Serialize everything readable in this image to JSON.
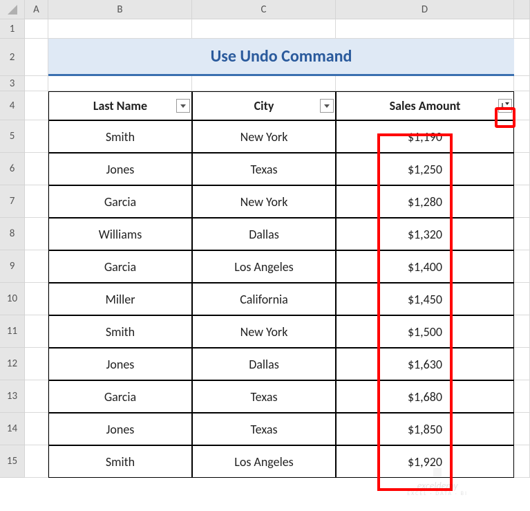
{
  "columns": [
    "A",
    "B",
    "C",
    "D"
  ],
  "rows": [
    "1",
    "2",
    "3",
    "4",
    "5",
    "6",
    "7",
    "8",
    "9",
    "10",
    "11",
    "12",
    "13",
    "14",
    "15"
  ],
  "title": "Use Undo Command",
  "headers": {
    "last_name": "Last Name",
    "city": "City",
    "sales_amount": "Sales Amount"
  },
  "data": [
    {
      "last_name": "Smith",
      "city": "New York",
      "sales": "$1,190"
    },
    {
      "last_name": "Jones",
      "city": "Texas",
      "sales": "$1,250"
    },
    {
      "last_name": "Garcia",
      "city": "New York",
      "sales": "$1,280"
    },
    {
      "last_name": "Williams",
      "city": "Dallas",
      "sales": "$1,320"
    },
    {
      "last_name": "Garcia",
      "city": "Los Angeles",
      "sales": "$1,400"
    },
    {
      "last_name": "Miller",
      "city": "California",
      "sales": "$1,450"
    },
    {
      "last_name": "Smith",
      "city": "New York",
      "sales": "$1,500"
    },
    {
      "last_name": "Jones",
      "city": "Dallas",
      "sales": "$1,630"
    },
    {
      "last_name": "Garcia",
      "city": "Texas",
      "sales": "$1,680"
    },
    {
      "last_name": "Jones",
      "city": "Texas",
      "sales": "$1,850"
    },
    {
      "last_name": "Smith",
      "city": "Los Angeles",
      "sales": "$1,920"
    }
  ],
  "watermark": {
    "main": "exceldemy",
    "sub": "EXCEL · DATA · BI"
  },
  "chart_data": {
    "type": "table",
    "title": "Use Undo Command",
    "columns": [
      "Last Name",
      "City",
      "Sales Amount"
    ],
    "rows": [
      [
        "Smith",
        "New York",
        1190
      ],
      [
        "Jones",
        "Texas",
        1250
      ],
      [
        "Garcia",
        "New York",
        1280
      ],
      [
        "Williams",
        "Dallas",
        1320
      ],
      [
        "Garcia",
        "Los Angeles",
        1400
      ],
      [
        "Miller",
        "California",
        1450
      ],
      [
        "Smith",
        "New York",
        1500
      ],
      [
        "Jones",
        "Dallas",
        1630
      ],
      [
        "Garcia",
        "Texas",
        1680
      ],
      [
        "Jones",
        "Texas",
        1850
      ],
      [
        "Smith",
        "Los Angeles",
        1920
      ]
    ],
    "sorted_by": "Sales Amount",
    "sort_order": "ascending"
  }
}
